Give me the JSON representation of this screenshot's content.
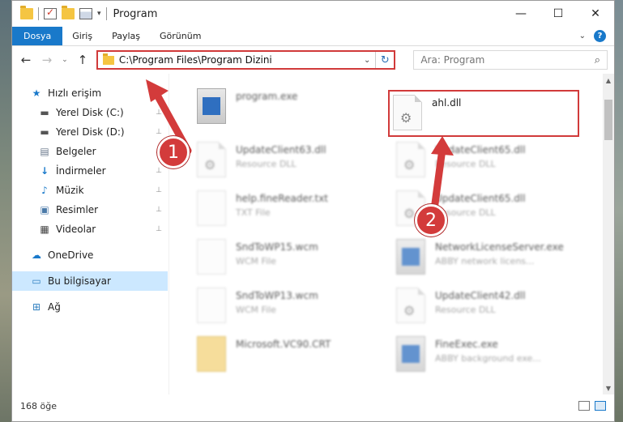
{
  "window": {
    "title": "Program",
    "controls": {
      "minimize": "—",
      "maximize": "☐",
      "close": "✕"
    }
  },
  "qat": {
    "dropdown": "▾"
  },
  "ribbon": {
    "tabs": [
      "Dosya",
      "Giriş",
      "Paylaş",
      "Görünüm"
    ],
    "expand": "⌄",
    "help": "?"
  },
  "address": {
    "path": "C:\\Program Files\\Program Dizini",
    "dropdown": "⌄",
    "refresh": "↻"
  },
  "search": {
    "placeholder": "Ara: Program",
    "icon": "⌕"
  },
  "nav_buttons": {
    "back": "←",
    "forward": "→",
    "recent": "⌄",
    "up": "↑"
  },
  "sidebar": {
    "quick_access": "Hızlı erişim",
    "items": [
      {
        "label": "Yerel Disk (C:)",
        "icon": "drive-icon",
        "glyph": "▬",
        "pinned": true
      },
      {
        "label": "Yerel Disk (D:)",
        "icon": "drive-icon",
        "glyph": "▬",
        "pinned": true
      },
      {
        "label": "Belgeler",
        "icon": "documents-icon",
        "glyph": "▤",
        "pinned": true
      },
      {
        "label": "İndirmeler",
        "icon": "downloads-icon",
        "glyph": "↓",
        "pinned": true
      },
      {
        "label": "Müzik",
        "icon": "music-icon",
        "glyph": "♪",
        "pinned": true
      },
      {
        "label": "Resimler",
        "icon": "pictures-icon",
        "glyph": "▣",
        "pinned": true
      },
      {
        "label": "Videolar",
        "icon": "videos-icon",
        "glyph": "▦",
        "pinned": true
      }
    ],
    "onedrive": "OneDrive",
    "this_pc": "Bu bilgisayar",
    "network": "Ağ",
    "pin_glyph": "📌"
  },
  "files": [
    {
      "name": "program.exe",
      "type": "",
      "icon": "exe"
    },
    {
      "name": "ahl.dll",
      "type": "",
      "icon": "dll"
    },
    {
      "name": "UpdateClient63.dll",
      "type": "Resource DLL",
      "icon": "dll"
    },
    {
      "name": "UpdateClient65.dll",
      "type": "Resource DLL",
      "icon": "dll"
    },
    {
      "name": "help.fineReader.txt",
      "type": "TXT File",
      "icon": "file"
    },
    {
      "name": "UpdateClient65.dll",
      "type": "Resource DLL",
      "icon": "dll"
    },
    {
      "name": "SndToWP15.wcm",
      "type": "WCM File",
      "icon": "file"
    },
    {
      "name": "NetworkLicenseServer.exe",
      "type": "ABBY network licens...",
      "icon": "exe"
    },
    {
      "name": "SndToWP13.wcm",
      "type": "WCM File",
      "icon": "file"
    },
    {
      "name": "UpdateClient42.dll",
      "type": "Resource DLL",
      "icon": "dll"
    },
    {
      "name": "Microsoft.VC90.CRT",
      "type": "",
      "icon": "folder"
    },
    {
      "name": "FineExec.exe",
      "type": "ABBY background exe...",
      "icon": "exe"
    }
  ],
  "status": {
    "count": "168 öğe"
  },
  "annotations": {
    "badge1": "1",
    "badge2": "2",
    "accent": "#d33b3b"
  }
}
